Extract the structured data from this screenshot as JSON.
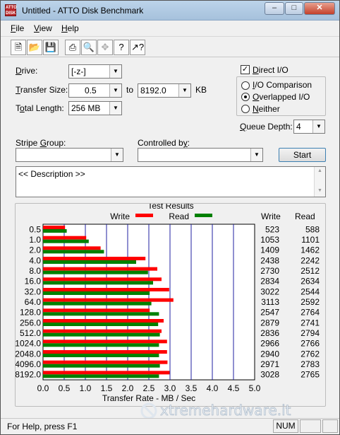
{
  "window": {
    "title": "Untitled - ATTO Disk Benchmark",
    "icon_text": "ATTO DISK BENCH"
  },
  "menu": [
    {
      "label": "File",
      "accel": "F",
      "rest": "ile"
    },
    {
      "label": "View",
      "accel": "V",
      "rest": "iew"
    },
    {
      "label": "Help",
      "accel": "H",
      "rest": "elp"
    }
  ],
  "toolbar": [
    "new-icon",
    "open-icon",
    "save-icon",
    "print-icon",
    "print-preview-icon",
    "move-icon",
    "help-icon",
    "context-help-icon"
  ],
  "form": {
    "drive_label": "Drive:",
    "drive_value": "[-z-]",
    "transfer_size_label": "Transfer Size:",
    "transfer_from": "0.5",
    "to_label": "to",
    "transfer_to": "8192.0",
    "kb_label": "KB",
    "total_length_label": "Total Length:",
    "total_length_value": "256 MB",
    "direct_io_label": "Direct I/O",
    "direct_io_checked": true,
    "radio_io_comparison": "I/O Comparison",
    "radio_overlapped": "Overlapped I/O",
    "radio_neither": "Neither",
    "queue_depth_label": "Queue Depth:",
    "queue_depth_value": "4",
    "stripe_group_label": "Stripe Group:",
    "controlled_by_label": "Controlled by:",
    "start_label": "Start",
    "description_text": "<< Description >>"
  },
  "chart_data": {
    "type": "bar",
    "title": "Test Results",
    "xlabel": "Transfer Rate - MB / Sec",
    "xlim": [
      0,
      5
    ],
    "xticks": [
      "0.0",
      "0.5",
      "1.0",
      "1.5",
      "2.0",
      "2.5",
      "3.0",
      "3.5",
      "4.0",
      "4.5",
      "5.0"
    ],
    "categories": [
      "0.5",
      "1.0",
      "2.0",
      "4.0",
      "8.0",
      "16.0",
      "32.0",
      "64.0",
      "128.0",
      "256.0",
      "512.0",
      "1024.0",
      "2048.0",
      "4096.0",
      "8192.0"
    ],
    "series": [
      {
        "name": "Write",
        "color": "#ff0000",
        "values": [
          0.52,
          1.02,
          1.36,
          2.42,
          2.7,
          2.8,
          2.98,
          3.08,
          2.52,
          2.85,
          2.8,
          2.93,
          2.93,
          2.94,
          2.99
        ],
        "table": [
          "523",
          "1053",
          "1409",
          "2438",
          "2730",
          "2834",
          "3022",
          "3113",
          "2547",
          "2879",
          "2836",
          "2966",
          "2940",
          "2971",
          "3028"
        ]
      },
      {
        "name": "Read",
        "color": "#008000",
        "values": [
          0.56,
          1.08,
          1.44,
          2.2,
          2.48,
          2.6,
          2.52,
          2.56,
          2.74,
          2.72,
          2.76,
          2.74,
          2.74,
          2.76,
          2.74
        ],
        "table": [
          "588",
          "1101",
          "1462",
          "2242",
          "2512",
          "2634",
          "2544",
          "2592",
          "2764",
          "2741",
          "2794",
          "2766",
          "2762",
          "2783",
          "2765"
        ]
      }
    ],
    "table_headers": [
      "Write",
      "Read"
    ],
    "grid": true
  },
  "status": {
    "help_text": "For Help, press F1",
    "num": "NUM"
  },
  "watermark": "xtremehardware.it"
}
